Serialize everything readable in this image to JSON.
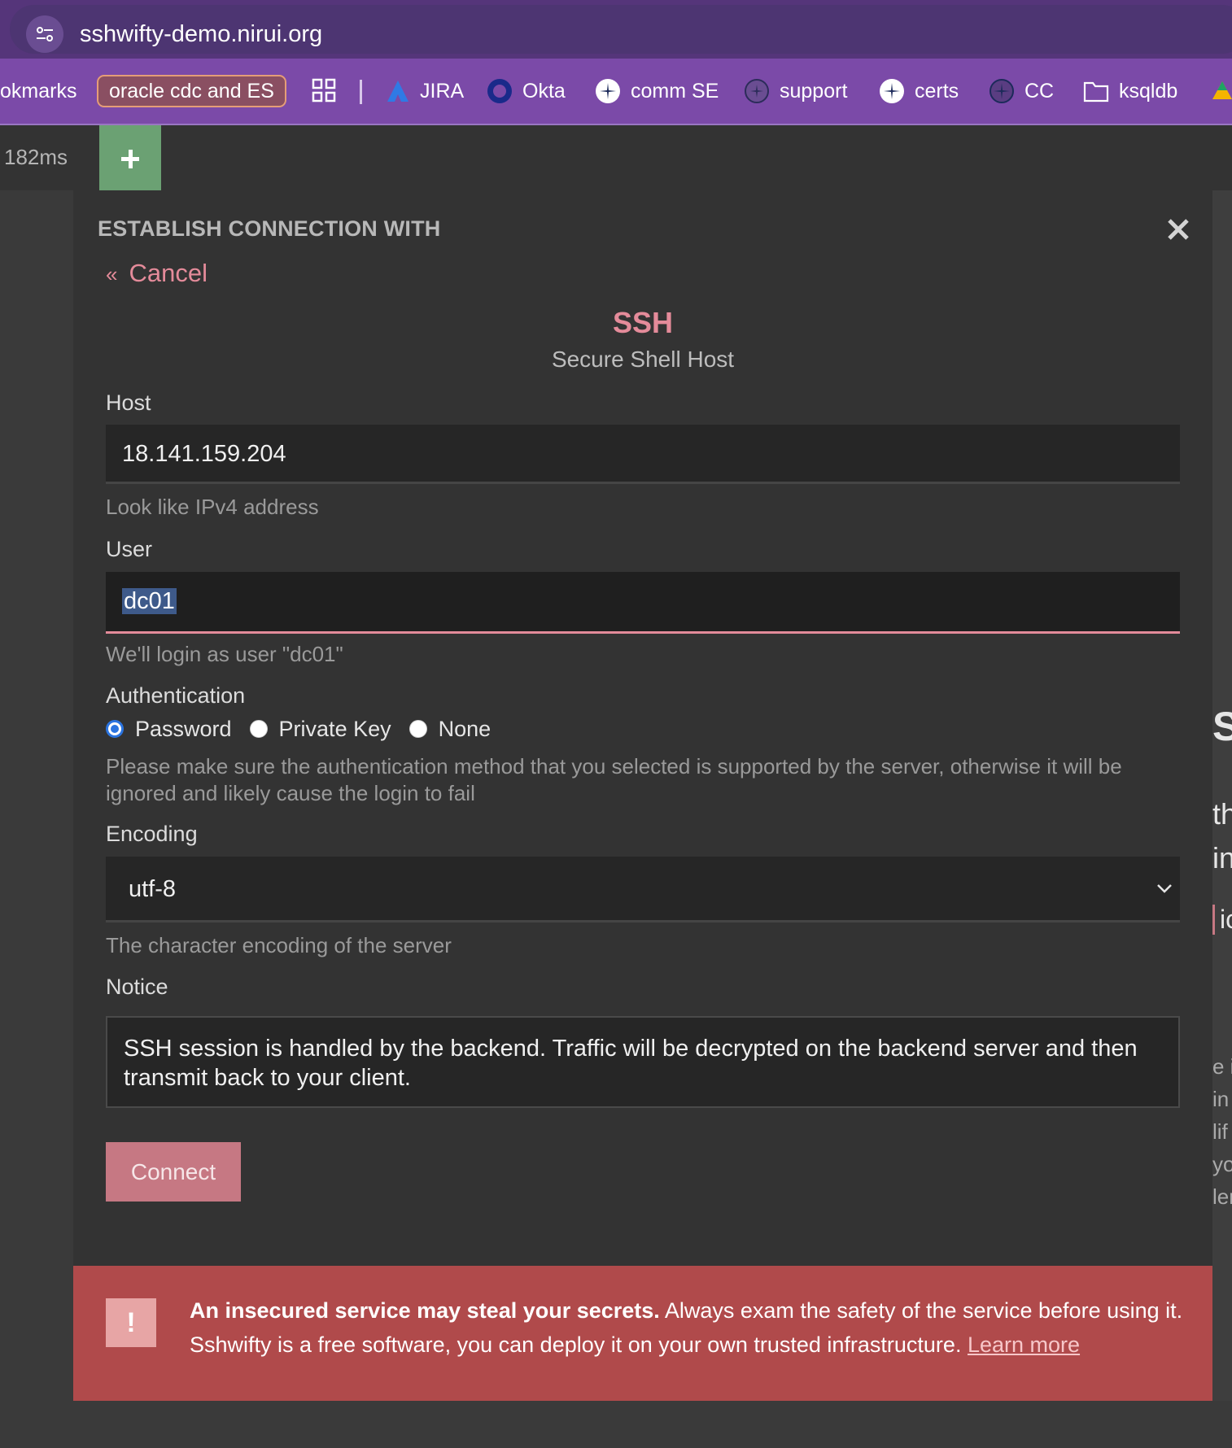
{
  "browser": {
    "url": "sshwifty-demo.nirui.org",
    "bookmarks": [
      {
        "label": "okmarks",
        "icon": "none"
      },
      {
        "label": "oracle cdc and ES",
        "icon": "folder-chip"
      },
      {
        "label": "JIRA",
        "icon": "jira-icon"
      },
      {
        "label": "Okta",
        "icon": "okta-icon"
      },
      {
        "label": "comm SE",
        "icon": "star-burst-icon"
      },
      {
        "label": "support",
        "icon": "star-burst-icon"
      },
      {
        "label": "certs",
        "icon": "star-burst-icon"
      },
      {
        "label": "CC",
        "icon": "star-burst-icon"
      },
      {
        "label": "ksqldb",
        "icon": "folder-icon"
      }
    ]
  },
  "page": {
    "latency": "182ms",
    "right_fragments": [
      "S",
      "th",
      "in",
      "ic",
      "e i",
      "in",
      "lif",
      "yo",
      "ler"
    ]
  },
  "dialog": {
    "title": "ESTABLISH CONNECTION WITH",
    "cancel_glyph": "«",
    "cancel_label": "Cancel",
    "protocol": "SSH",
    "protocol_desc": "Secure Shell Host",
    "host": {
      "label": "Host",
      "value": "18.141.159.204",
      "hint": "Look like IPv4 address"
    },
    "user": {
      "label": "User",
      "value": "dc01",
      "hint": "We'll login as user \"dc01\""
    },
    "auth": {
      "label": "Authentication",
      "options": [
        "Password",
        "Private Key",
        "None"
      ],
      "selected": "Password",
      "note": "Please make sure the authentication method that you selected is supported by the server, otherwise it will be ignored and likely cause the login to fail"
    },
    "encoding": {
      "label": "Encoding",
      "value": "utf-8",
      "hint": "The character encoding of the server"
    },
    "notice": {
      "label": "Notice",
      "text": "SSH session is handled by the backend. Traffic will be decrypted on the backend server and then transmit back to your client."
    },
    "connect_label": "Connect"
  },
  "warning": {
    "badge": "!",
    "bold": "An insecured service may steal your secrets.",
    "rest": " Always exam the safety of the service before using it.",
    "line2": "Sshwifty is a free software, you can deploy it on your own trusted infrastructure.",
    "link": "Learn more"
  },
  "colors": {
    "accent": "#e48b9a",
    "warning_bg": "#b04a4b",
    "connect_bg": "#c67883",
    "plus_tab": "#6ba173",
    "browser_purple": "#7b4aa8"
  }
}
